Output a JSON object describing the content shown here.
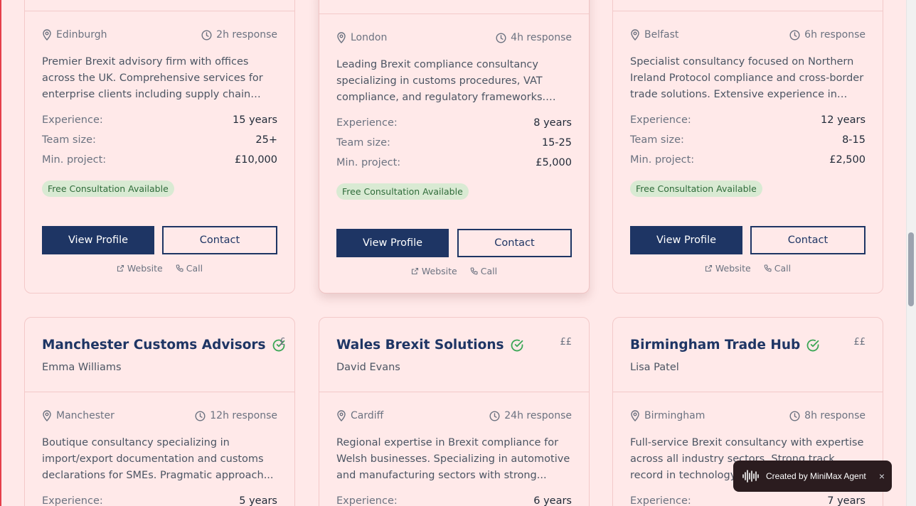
{
  "top_cards": [
    {
      "location": "Edinburgh",
      "response": "2h response",
      "description": "Premier Brexit advisory firm with offices across the UK. Comprehensive services for enterprise clients including supply chain optimization,...",
      "experience_label": "Experience:",
      "experience": "15 years",
      "team_label": "Team size:",
      "team": "25+",
      "min_label": "Min. project:",
      "min": "£10,000",
      "badge": "Free Consultation Available",
      "view": "View Profile",
      "contact": "Contact",
      "website": "Website",
      "call": "Call"
    },
    {
      "location": "London",
      "response": "4h response",
      "description": "Leading Brexit compliance consultancy specializing in customs procedures, VAT compliance, and regulatory frameworks. We...",
      "experience_label": "Experience:",
      "experience": "8 years",
      "team_label": "Team size:",
      "team": "15-25",
      "min_label": "Min. project:",
      "min": "£5,000",
      "badge": "Free Consultation Available",
      "view": "View Profile",
      "contact": "Contact",
      "website": "Website",
      "call": "Call"
    },
    {
      "location": "Belfast",
      "response": "6h response",
      "description": "Specialist consultancy focused on Northern Ireland Protocol compliance and cross-border trade solutions. Extensive experience in food...",
      "experience_label": "Experience:",
      "experience": "12 years",
      "team_label": "Team size:",
      "team": "8-15",
      "min_label": "Min. project:",
      "min": "£2,500",
      "badge": "Free Consultation Available",
      "view": "View Profile",
      "contact": "Contact",
      "website": "Website",
      "call": "Call"
    }
  ],
  "bottom_cards": [
    {
      "name": "Manchester Customs Advisors",
      "price": "£",
      "person": "Emma Williams",
      "location": "Manchester",
      "response": "12h response",
      "description": "Boutique consultancy specializing in import/export documentation and customs declarations for SMEs. Pragmatic approach...",
      "experience_label": "Experience:",
      "experience": "5 years"
    },
    {
      "name": "Wales Brexit Solutions",
      "price": "££",
      "person": "David Evans",
      "location": "Cardiff",
      "response": "24h response",
      "description": "Regional expertise in Brexit compliance for Welsh businesses. Specializing in automotive and manufacturing sectors with strong...",
      "experience_label": "Experience:",
      "experience": "6 years"
    },
    {
      "name": "Birmingham Trade Hub",
      "price": "££",
      "person": "Lisa Patel",
      "location": "Birmingham",
      "response": "8h response",
      "description": "Full-service Brexit consultancy with expertise across all industry sectors. Strong track record in technology and pharmaceutical...",
      "experience_label": "Experience:",
      "experience": "7 years"
    }
  ],
  "toast": {
    "label": "Created by MiniMax Agent",
    "close": "×"
  },
  "colors": {
    "primary": "#1e3564",
    "background": "#ffe9e9",
    "badge_bg": "#d9ead3",
    "verified": "#3aa655"
  },
  "icons": [
    "map-pin-icon",
    "clock-icon",
    "external-link-icon",
    "phone-icon",
    "verified-check-icon",
    "waveform-icon",
    "close-icon"
  ]
}
